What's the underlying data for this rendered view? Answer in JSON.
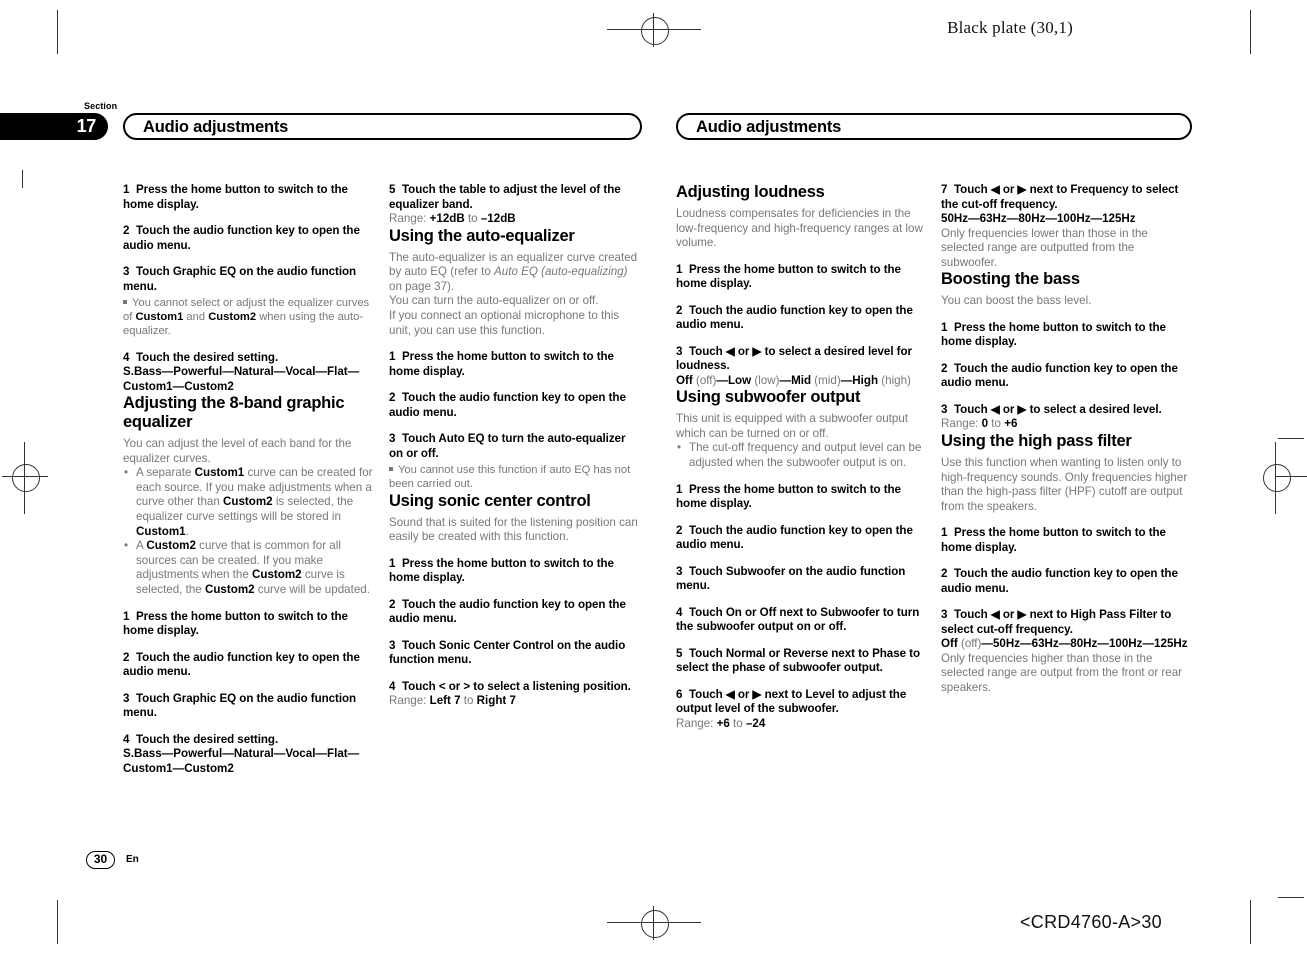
{
  "page": {
    "black_plate": "Black plate (30,1)",
    "part_number": "<CRD4760-A>30",
    "section_word": "Section",
    "section_number": "17",
    "page_number": "30",
    "language": "En"
  },
  "headers": {
    "left": "Audio adjustments",
    "right": "Audio adjustments"
  },
  "columns": {
    "col1": {
      "steps_top": [
        {
          "num": "1",
          "text": "Press the home button to switch to the home display."
        },
        {
          "num": "2",
          "text": "Touch the audio function key to open the audio menu."
        },
        {
          "num": "3",
          "text": "Touch Graphic EQ on the audio function menu."
        }
      ],
      "note_3": {
        "pre": "You cannot select or adjust the equalizer curves of ",
        "b1": "Custom1",
        "mid": " and ",
        "b2": "Custom2",
        "post": " when using the auto-equalizer."
      },
      "step4": {
        "num": "4",
        "text": "Touch the desired setting."
      },
      "step4_options": "S.Bass—Powerful—Natural—Vocal—Flat—Custom1—Custom2",
      "section_title": "Adjusting the 8-band graphic equalizer",
      "section_intro": "You can adjust the level of each band for the equalizer curves.",
      "bullets": [
        {
          "p1": "A separate ",
          "b1": "Custom1",
          "p2": " curve can be created for each source. If you make adjustments when a curve other than ",
          "b2": "Custom2",
          "p3": " is selected, the equalizer curve settings will be stored in ",
          "b3": "Custom1",
          "p4": "."
        },
        {
          "p1": "A ",
          "b1": "Custom2",
          "p2": " curve that is common for all sources can be created. If you make adjustments when the ",
          "b2": "Custom2",
          "p3": " curve is selected, the ",
          "b3": "Custom2",
          "p4": " curve will be updated."
        }
      ],
      "steps_bottom": [
        {
          "num": "1",
          "text": "Press the home button to switch to the home display."
        },
        {
          "num": "2",
          "text": "Touch the audio function key to open the audio menu."
        },
        {
          "num": "3",
          "text": "Touch Graphic EQ on the audio function menu."
        },
        {
          "num": "4",
          "text": "Touch the desired setting."
        }
      ],
      "step4b_options": "S.Bass—Powerful—Natural—Vocal—Flat—Custom1—Custom2"
    },
    "col2": {
      "step5": {
        "num": "5",
        "text": "Touch the table to adjust the level of the equalizer band."
      },
      "step5_range_label": "Range: ",
      "step5_range_from": "+12dB",
      "step5_range_to_word": " to ",
      "step5_range_to": "–12dB",
      "section_title": "Using the auto-equalizer",
      "intro_p1_a": "The auto-equalizer is an equalizer curve created by auto EQ (refer to ",
      "intro_p1_italic": "Auto EQ (auto-equalizing)",
      "intro_p1_b": " on page 37).",
      "intro_p2": "You can turn the auto-equalizer on or off.",
      "intro_p3": "If you connect an optional microphone to this unit, you can use this function.",
      "steps": [
        {
          "num": "1",
          "text": "Press the home button to switch to the home display."
        },
        {
          "num": "2",
          "text": "Touch the audio function key to open the audio menu."
        },
        {
          "num": "3",
          "text": "Touch Auto EQ to turn the auto-equalizer on or off."
        }
      ],
      "note": "You cannot use this function if auto EQ has not been carried out.",
      "section_title2": "Using sonic center control",
      "intro2": "Sound that is suited for the listening position can easily be created with this function.",
      "steps2": [
        {
          "num": "1",
          "text": "Press the home button to switch to the home display."
        },
        {
          "num": "2",
          "text": "Touch the audio function key to open the audio menu."
        },
        {
          "num": "3",
          "text": "Touch Sonic Center Control on the audio function menu."
        },
        {
          "num": "4",
          "text": "Touch < or > to select a listening position."
        }
      ],
      "range2_label": "Range: ",
      "range2_from": "Left 7",
      "range2_to_word": " to ",
      "range2_to": "Right 7"
    },
    "col3": {
      "section_title": "Adjusting loudness",
      "intro": "Loudness compensates for deficiencies in the low-frequency and high-frequency ranges at low volume.",
      "steps": [
        {
          "num": "1",
          "text": "Press the home button to switch to the home display."
        },
        {
          "num": "2",
          "text": "Touch the audio function key to open the audio menu."
        },
        {
          "num": "3",
          "text": "Touch ◀ or ▶ to select a desired level for loudness."
        }
      ],
      "loudness_options": [
        {
          "b": "Off",
          "d": " (off)"
        },
        {
          "sep": "—",
          "b": "Low",
          "d": " (low)"
        },
        {
          "sep": "—",
          "b": "Mid",
          "d": " (mid)"
        },
        {
          "sep": "—",
          "b": "High",
          "d": " (high)"
        }
      ],
      "section_title2": "Using subwoofer output",
      "intro2": "This unit is equipped with a subwoofer output which can be turned on or off.",
      "bullet2": "The cut-off frequency and output level can be adjusted when the subwoofer output is on.",
      "steps2": [
        {
          "num": "1",
          "text": "Press the home button to switch to the home display."
        },
        {
          "num": "2",
          "text": "Touch the audio function key to open the audio menu."
        },
        {
          "num": "3",
          "text": "Touch Subwoofer on the audio function menu."
        },
        {
          "num": "4",
          "text": "Touch On or Off next to Subwoofer to turn the subwoofer output on or off."
        },
        {
          "num": "5",
          "text": "Touch Normal or Reverse next to Phase to select the phase of subwoofer output."
        },
        {
          "num": "6",
          "text": "Touch ◀ or ▶ next to Level to adjust the output level of the subwoofer."
        }
      ],
      "range_label": "Range: ",
      "range_from": "+6",
      "range_to_word": " to ",
      "range_to": "–24"
    },
    "col4": {
      "step7": {
        "num": "7",
        "text": "Touch ◀ or ▶ next to Frequency to select the cut-off frequency."
      },
      "step7_options": "50Hz—63Hz—80Hz—100Hz—125Hz",
      "step7_note": "Only frequencies lower than those in the selected range are outputted from the subwoofer.",
      "section_title": "Boosting the bass",
      "intro": "You can boost the bass level.",
      "steps": [
        {
          "num": "1",
          "text": "Press the home button to switch to the home display."
        },
        {
          "num": "2",
          "text": "Touch the audio function key to open the audio menu."
        },
        {
          "num": "3",
          "text": "Touch ◀ or ▶ to select a desired level."
        }
      ],
      "range_label": "Range: ",
      "range_from": "0",
      "range_to_word": " to ",
      "range_to": "+6",
      "section_title2": "Using the high pass filter",
      "intro2": "Use this function when wanting to listen only to high-frequency sounds. Only frequencies higher than the high-pass filter (HPF) cutoff are output from the speakers.",
      "steps2": [
        {
          "num": "1",
          "text": "Press the home button to switch to the home display."
        },
        {
          "num": "2",
          "text": "Touch the audio function key to open the audio menu."
        },
        {
          "num": "3",
          "text": "Touch ◀ or ▶ next to High Pass Filter to select cut-off frequency."
        }
      ],
      "hpf_off": "Off",
      "hpf_off_dim": " (off)",
      "hpf_options": "—50Hz—63Hz—80Hz—100Hz—125Hz",
      "hpf_note": "Only frequencies higher than those in the selected range are output from the front or rear speakers."
    }
  }
}
